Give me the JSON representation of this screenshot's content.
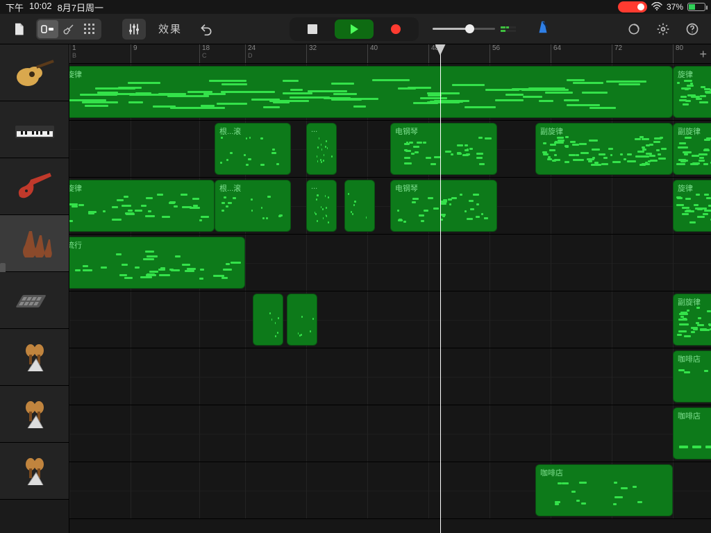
{
  "status": {
    "time_prefix": "下午",
    "time": "10:02",
    "date": "8月7日周一",
    "battery_pct": "37%"
  },
  "toolbar": {
    "fx": "效果"
  },
  "ruler": {
    "ticks": [
      {
        "n": "1",
        "sub": "B"
      },
      {
        "n": "9"
      },
      {
        "n": "18",
        "sub": "C"
      },
      {
        "n": "24",
        "sub": "D"
      },
      {
        "n": "32"
      },
      {
        "n": "40"
      },
      {
        "n": "48"
      },
      {
        "n": "56"
      },
      {
        "n": "64"
      },
      {
        "n": "72"
      },
      {
        "n": "80"
      }
    ],
    "add": "+"
  },
  "playhead_at": 49.5,
  "tracks": [
    {
      "kind": "acoustic-guitar",
      "selected": false,
      "regions": [
        {
          "start": 0,
          "end": 80,
          "label": "旋律",
          "density": "high"
        },
        {
          "start": 80,
          "end": 100,
          "label": "旋律",
          "density": "high"
        }
      ]
    },
    {
      "kind": "keyboard",
      "selected": false,
      "regions": [
        {
          "start": 20,
          "end": 30,
          "label": "根...滚",
          "density": "sparse"
        },
        {
          "start": 32,
          "end": 36,
          "label": "...",
          "density": "sparse"
        },
        {
          "start": 43,
          "end": 57,
          "label": "电钢琴",
          "density": "mid"
        },
        {
          "start": 62,
          "end": 80,
          "label": "副旋律",
          "density": "high"
        },
        {
          "start": 80,
          "end": 100,
          "label": "副旋律",
          "density": "high"
        }
      ]
    },
    {
      "kind": "electric-guitar",
      "selected": false,
      "regions": [
        {
          "start": 0,
          "end": 20,
          "label": "旋律",
          "density": "mid"
        },
        {
          "start": 20,
          "end": 30,
          "label": "根...滚",
          "density": "sparse"
        },
        {
          "start": 32,
          "end": 36,
          "label": "...",
          "density": "sparse"
        },
        {
          "start": 37,
          "end": 41,
          "label": "",
          "density": "tiny"
        },
        {
          "start": 43,
          "end": 57,
          "label": "电钢琴",
          "density": "mid"
        },
        {
          "start": 80,
          "end": 100,
          "label": "旋律",
          "density": "high"
        }
      ]
    },
    {
      "kind": "strings",
      "selected": true,
      "regions": [
        {
          "start": 0,
          "end": 24,
          "label": "流行",
          "density": "mid"
        }
      ]
    },
    {
      "kind": "drum-machine",
      "selected": false,
      "regions": [
        {
          "start": 25,
          "end": 29,
          "label": "",
          "density": "tiny"
        },
        {
          "start": 29.5,
          "end": 33.5,
          "label": "",
          "density": "tiny"
        },
        {
          "start": 80,
          "end": 100,
          "label": "副旋律",
          "density": "high"
        }
      ]
    },
    {
      "kind": "percussion",
      "selected": false,
      "regions": [
        {
          "start": 80,
          "end": 100,
          "label": "咖啡店",
          "density": "sparse"
        }
      ]
    },
    {
      "kind": "percussion",
      "selected": false,
      "regions": [
        {
          "start": 80,
          "end": 100,
          "label": "咖啡店",
          "density": "bars"
        }
      ]
    },
    {
      "kind": "percussion",
      "selected": false,
      "regions": [
        {
          "start": 62,
          "end": 80,
          "label": "咖啡店",
          "density": "sparse"
        }
      ]
    }
  ],
  "timeline": {
    "left_bar": 1,
    "right_bar": 85
  }
}
